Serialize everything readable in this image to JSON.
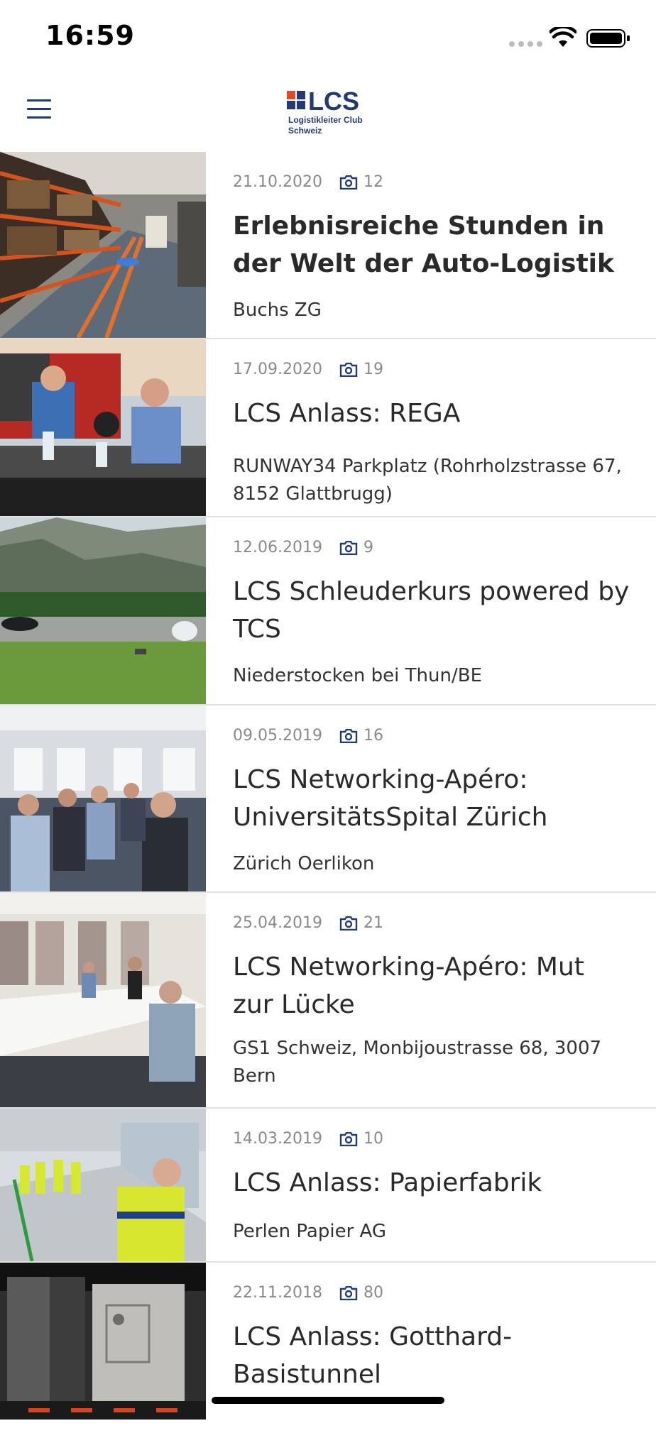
{
  "status": {
    "time": "16:59"
  },
  "header": {
    "logo_name": "LCS",
    "logo_line1": "Logistikleiter Club",
    "logo_line2": "Schweiz"
  },
  "colors": {
    "brand": "#233a74",
    "accent": "#e2492b",
    "meta": "#8a8a8a",
    "divider": "#e2e2e2"
  },
  "events": [
    {
      "date": "21.10.2020",
      "photos": "12",
      "title": "Erlebnisreiche Stunden in der Welt der Auto-Logistik",
      "location": "Buchs ZG",
      "photo_icon": "camera-icon"
    },
    {
      "date": "17.09.2020",
      "photos": "19",
      "title": "LCS Anlass: REGA",
      "location": "RUNWAY34 Parkplatz (Rohrholzstrasse 67, 8152 Glattbrugg)",
      "photo_icon": "camera-icon"
    },
    {
      "date": "12.06.2019",
      "photos": "9",
      "title": "LCS Schleuderkurs powered by TCS",
      "location": "Niederstocken bei Thun/BE",
      "photo_icon": "camera-icon"
    },
    {
      "date": "09.05.2019",
      "photos": "16",
      "title": "LCS Networking-Apéro: UniversitätsSpital Zürich",
      "location": "Zürich Oerlikon",
      "photo_icon": "camera-icon"
    },
    {
      "date": "25.04.2019",
      "photos": "21",
      "title": "LCS Networking-Apéro: Mut zur Lücke",
      "location": "GS1 Schweiz, Monbijoustrasse 68, 3007 Bern",
      "photo_icon": "camera-icon"
    },
    {
      "date": "14.03.2019",
      "photos": "10",
      "title": "LCS Anlass: Papierfabrik",
      "location": "Perlen Papier AG",
      "photo_icon": "camera-icon"
    },
    {
      "date": "22.11.2018",
      "photos": "80",
      "title": "LCS Anlass: Gotthard-Basistunnel",
      "location": "",
      "photo_icon": "camera-icon"
    }
  ]
}
